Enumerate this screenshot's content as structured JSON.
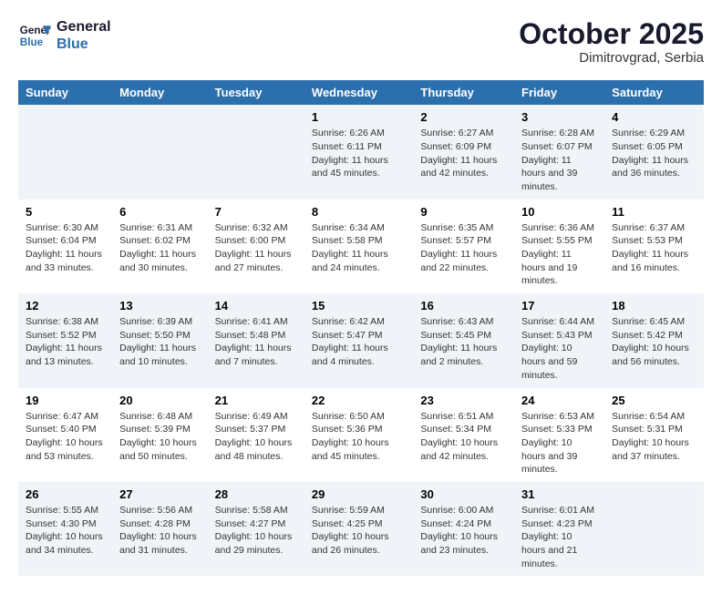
{
  "header": {
    "logo_line1": "General",
    "logo_line2": "Blue",
    "month": "October 2025",
    "location": "Dimitrovgrad, Serbia"
  },
  "weekdays": [
    "Sunday",
    "Monday",
    "Tuesday",
    "Wednesday",
    "Thursday",
    "Friday",
    "Saturday"
  ],
  "weeks": [
    [
      {
        "day": "",
        "info": ""
      },
      {
        "day": "",
        "info": ""
      },
      {
        "day": "",
        "info": ""
      },
      {
        "day": "1",
        "info": "Sunrise: 6:26 AM\nSunset: 6:11 PM\nDaylight: 11 hours and 45 minutes."
      },
      {
        "day": "2",
        "info": "Sunrise: 6:27 AM\nSunset: 6:09 PM\nDaylight: 11 hours and 42 minutes."
      },
      {
        "day": "3",
        "info": "Sunrise: 6:28 AM\nSunset: 6:07 PM\nDaylight: 11 hours and 39 minutes."
      },
      {
        "day": "4",
        "info": "Sunrise: 6:29 AM\nSunset: 6:05 PM\nDaylight: 11 hours and 36 minutes."
      }
    ],
    [
      {
        "day": "5",
        "info": "Sunrise: 6:30 AM\nSunset: 6:04 PM\nDaylight: 11 hours and 33 minutes."
      },
      {
        "day": "6",
        "info": "Sunrise: 6:31 AM\nSunset: 6:02 PM\nDaylight: 11 hours and 30 minutes."
      },
      {
        "day": "7",
        "info": "Sunrise: 6:32 AM\nSunset: 6:00 PM\nDaylight: 11 hours and 27 minutes."
      },
      {
        "day": "8",
        "info": "Sunrise: 6:34 AM\nSunset: 5:58 PM\nDaylight: 11 hours and 24 minutes."
      },
      {
        "day": "9",
        "info": "Sunrise: 6:35 AM\nSunset: 5:57 PM\nDaylight: 11 hours and 22 minutes."
      },
      {
        "day": "10",
        "info": "Sunrise: 6:36 AM\nSunset: 5:55 PM\nDaylight: 11 hours and 19 minutes."
      },
      {
        "day": "11",
        "info": "Sunrise: 6:37 AM\nSunset: 5:53 PM\nDaylight: 11 hours and 16 minutes."
      }
    ],
    [
      {
        "day": "12",
        "info": "Sunrise: 6:38 AM\nSunset: 5:52 PM\nDaylight: 11 hours and 13 minutes."
      },
      {
        "day": "13",
        "info": "Sunrise: 6:39 AM\nSunset: 5:50 PM\nDaylight: 11 hours and 10 minutes."
      },
      {
        "day": "14",
        "info": "Sunrise: 6:41 AM\nSunset: 5:48 PM\nDaylight: 11 hours and 7 minutes."
      },
      {
        "day": "15",
        "info": "Sunrise: 6:42 AM\nSunset: 5:47 PM\nDaylight: 11 hours and 4 minutes."
      },
      {
        "day": "16",
        "info": "Sunrise: 6:43 AM\nSunset: 5:45 PM\nDaylight: 11 hours and 2 minutes."
      },
      {
        "day": "17",
        "info": "Sunrise: 6:44 AM\nSunset: 5:43 PM\nDaylight: 10 hours and 59 minutes."
      },
      {
        "day": "18",
        "info": "Sunrise: 6:45 AM\nSunset: 5:42 PM\nDaylight: 10 hours and 56 minutes."
      }
    ],
    [
      {
        "day": "19",
        "info": "Sunrise: 6:47 AM\nSunset: 5:40 PM\nDaylight: 10 hours and 53 minutes."
      },
      {
        "day": "20",
        "info": "Sunrise: 6:48 AM\nSunset: 5:39 PM\nDaylight: 10 hours and 50 minutes."
      },
      {
        "day": "21",
        "info": "Sunrise: 6:49 AM\nSunset: 5:37 PM\nDaylight: 10 hours and 48 minutes."
      },
      {
        "day": "22",
        "info": "Sunrise: 6:50 AM\nSunset: 5:36 PM\nDaylight: 10 hours and 45 minutes."
      },
      {
        "day": "23",
        "info": "Sunrise: 6:51 AM\nSunset: 5:34 PM\nDaylight: 10 hours and 42 minutes."
      },
      {
        "day": "24",
        "info": "Sunrise: 6:53 AM\nSunset: 5:33 PM\nDaylight: 10 hours and 39 minutes."
      },
      {
        "day": "25",
        "info": "Sunrise: 6:54 AM\nSunset: 5:31 PM\nDaylight: 10 hours and 37 minutes."
      }
    ],
    [
      {
        "day": "26",
        "info": "Sunrise: 5:55 AM\nSunset: 4:30 PM\nDaylight: 10 hours and 34 minutes."
      },
      {
        "day": "27",
        "info": "Sunrise: 5:56 AM\nSunset: 4:28 PM\nDaylight: 10 hours and 31 minutes."
      },
      {
        "day": "28",
        "info": "Sunrise: 5:58 AM\nSunset: 4:27 PM\nDaylight: 10 hours and 29 minutes."
      },
      {
        "day": "29",
        "info": "Sunrise: 5:59 AM\nSunset: 4:25 PM\nDaylight: 10 hours and 26 minutes."
      },
      {
        "day": "30",
        "info": "Sunrise: 6:00 AM\nSunset: 4:24 PM\nDaylight: 10 hours and 23 minutes."
      },
      {
        "day": "31",
        "info": "Sunrise: 6:01 AM\nSunset: 4:23 PM\nDaylight: 10 hours and 21 minutes."
      },
      {
        "day": "",
        "info": ""
      }
    ]
  ]
}
